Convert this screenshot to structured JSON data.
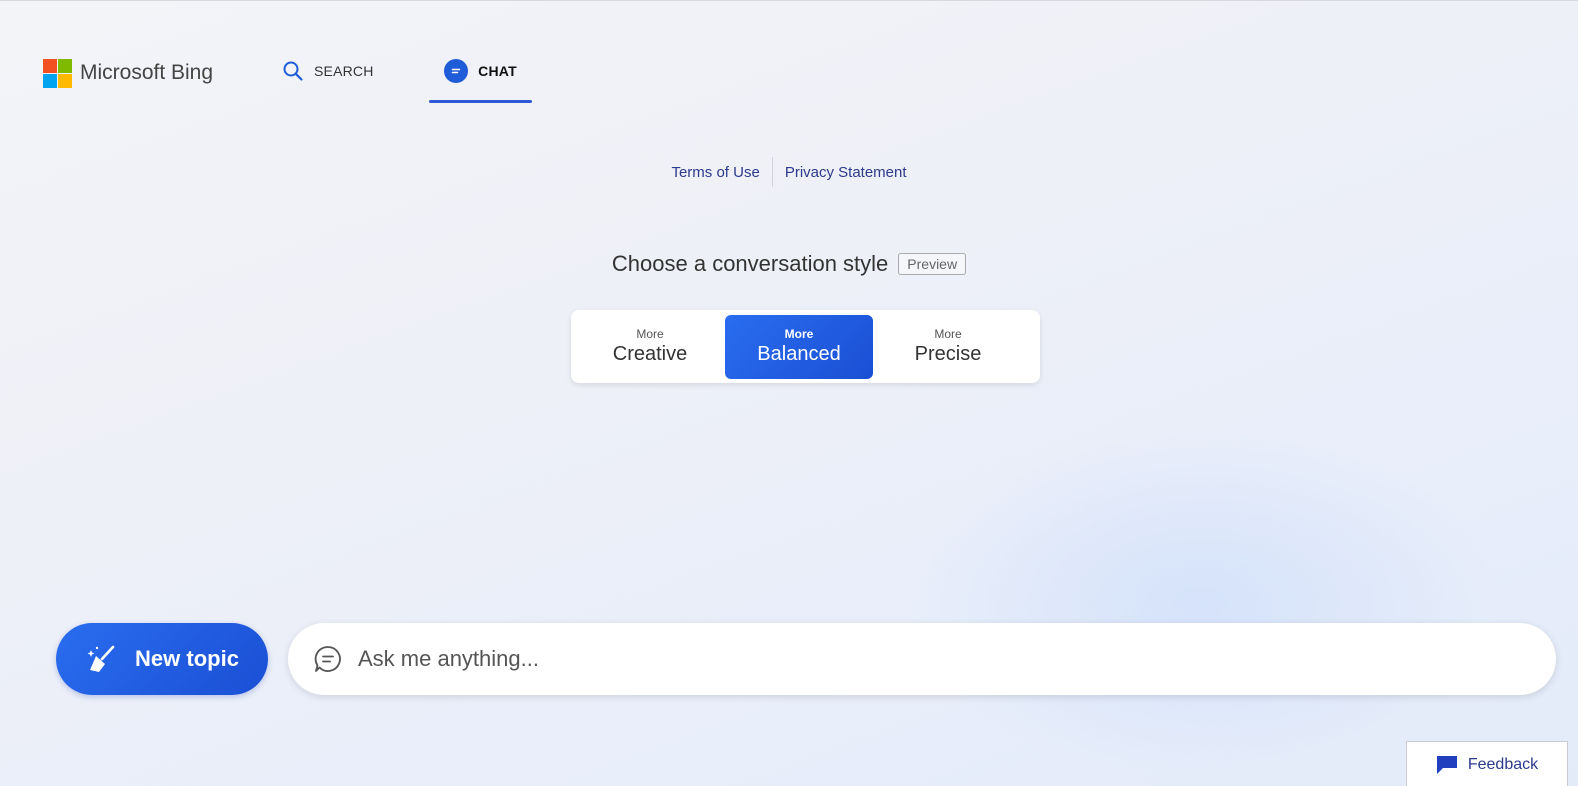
{
  "header": {
    "brand": "Microsoft Bing",
    "logo_colors": [
      "#f25022",
      "#7fba00",
      "#00a4ef",
      "#ffb900"
    ],
    "tabs": [
      {
        "label": "SEARCH",
        "icon": "search-icon",
        "active": false
      },
      {
        "label": "CHAT",
        "icon": "chat-bubble-icon",
        "active": true
      }
    ]
  },
  "links": {
    "terms": "Terms of Use",
    "privacy": "Privacy Statement"
  },
  "style_chooser": {
    "title": "Choose a conversation style",
    "badge": "Preview",
    "options": [
      {
        "small": "More",
        "label": "Creative",
        "selected": false
      },
      {
        "small": "More",
        "label": "Balanced",
        "selected": true
      },
      {
        "small": "More",
        "label": "Precise",
        "selected": false
      }
    ]
  },
  "composer": {
    "new_topic_label": "New topic",
    "new_topic_icon": "broom-icon",
    "input_placeholder": "Ask me anything...",
    "input_value": "",
    "input_icon": "chat-outline-icon"
  },
  "feedback": {
    "label": "Feedback",
    "icon": "feedback-flag-icon"
  },
  "colors": {
    "accent": "#1f5dd8",
    "link": "#2b3a8c"
  }
}
